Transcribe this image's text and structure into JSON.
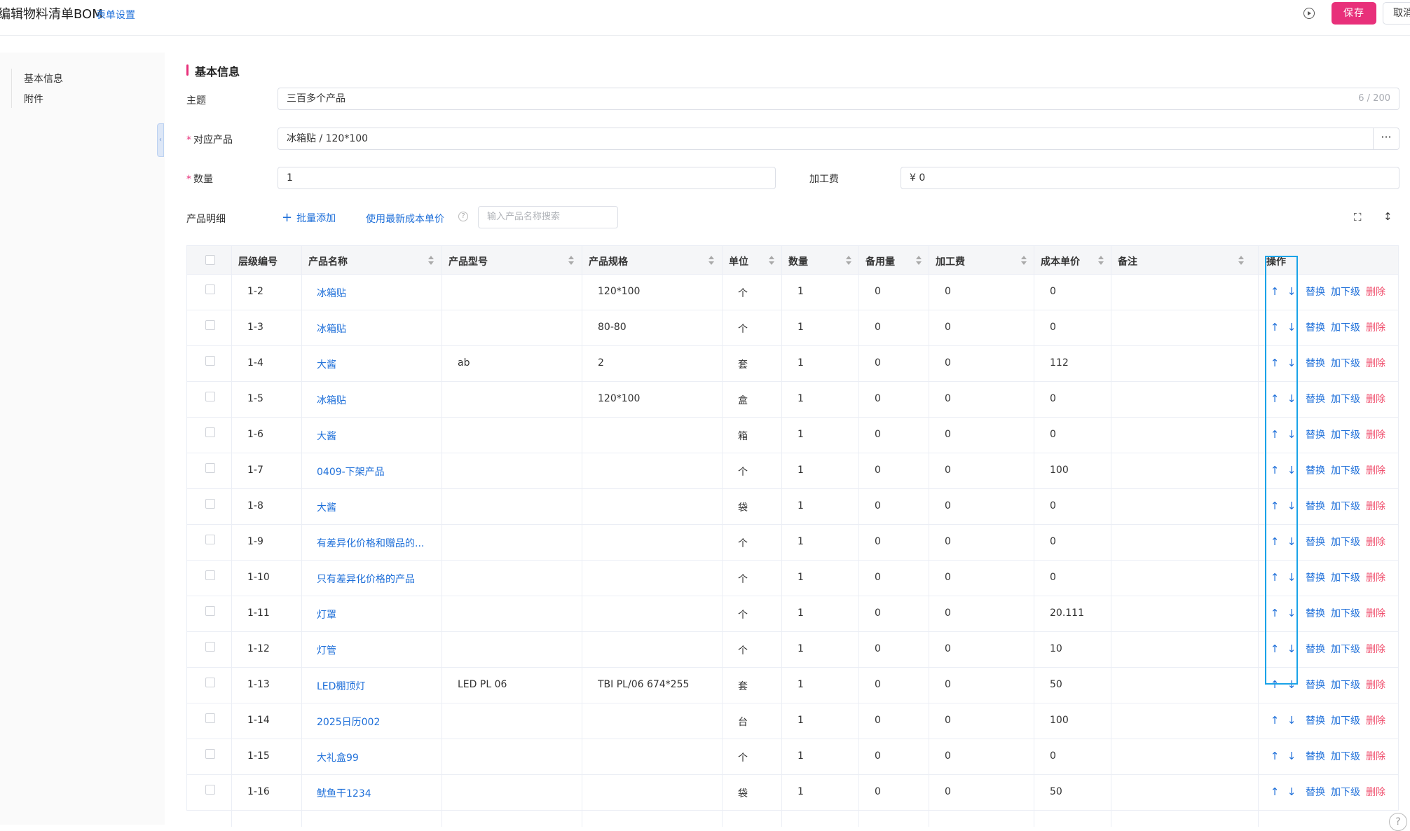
{
  "header": {
    "title": "编辑物料清单BOM",
    "form_settings": "表单设置",
    "save": "保存",
    "cancel": "取消"
  },
  "sidebar": {
    "items": [
      {
        "label": "基本信息"
      },
      {
        "label": "附件"
      }
    ]
  },
  "section": {
    "title": "基本信息"
  },
  "form": {
    "subject_label": "主题",
    "subject_value": "三百多个产品",
    "subject_counter": "6 / 200",
    "product_label": "对应产品",
    "product_value": "冰箱贴 / 120*100",
    "product_more": "···",
    "quantity_label": "数量",
    "quantity_value": "1",
    "fee_label": "加工费",
    "fee_value": "¥ 0",
    "required_mark": "*"
  },
  "toolbar": {
    "label": "产品明细",
    "batch_add": "批量添加",
    "use_latest_cost": "使用最新成本单价",
    "search_placeholder": "输入产品名称搜索"
  },
  "table": {
    "columns": [
      "层级编号",
      "产品名称",
      "产品型号",
      "产品规格",
      "单位",
      "数量",
      "备用量",
      "加工费",
      "成本单价",
      "备注",
      "操作"
    ],
    "ops": {
      "up": "↑",
      "down": "↓",
      "replace": "替换",
      "add_sub": "加下级",
      "delete": "删除"
    },
    "rows": [
      {
        "level": "1-2",
        "name": "冰箱贴",
        "model": "",
        "spec": "120*100",
        "unit": "个",
        "qty": "1",
        "spare": "0",
        "fee": "0",
        "cost": "0",
        "note": ""
      },
      {
        "level": "1-3",
        "name": "冰箱贴",
        "model": "",
        "spec": "80-80",
        "unit": "个",
        "qty": "1",
        "spare": "0",
        "fee": "0",
        "cost": "0",
        "note": ""
      },
      {
        "level": "1-4",
        "name": "大酱",
        "model": "ab",
        "spec": "2",
        "unit": "套",
        "qty": "1",
        "spare": "0",
        "fee": "0",
        "cost": "112",
        "note": ""
      },
      {
        "level": "1-5",
        "name": "冰箱贴",
        "model": "",
        "spec": "120*100",
        "unit": "盒",
        "qty": "1",
        "spare": "0",
        "fee": "0",
        "cost": "0",
        "note": ""
      },
      {
        "level": "1-6",
        "name": "大酱",
        "model": "",
        "spec": "",
        "unit": "箱",
        "qty": "1",
        "spare": "0",
        "fee": "0",
        "cost": "0",
        "note": ""
      },
      {
        "level": "1-7",
        "name": "0409-下架产品",
        "model": "",
        "spec": "",
        "unit": "个",
        "qty": "1",
        "spare": "0",
        "fee": "0",
        "cost": "100",
        "note": ""
      },
      {
        "level": "1-8",
        "name": "大酱",
        "model": "",
        "spec": "",
        "unit": "袋",
        "qty": "1",
        "spare": "0",
        "fee": "0",
        "cost": "0",
        "note": ""
      },
      {
        "level": "1-9",
        "name": "有差异化价格和赠品的...",
        "model": "",
        "spec": "",
        "unit": "个",
        "qty": "1",
        "spare": "0",
        "fee": "0",
        "cost": "0",
        "note": ""
      },
      {
        "level": "1-10",
        "name": "只有差异化价格的产品",
        "model": "",
        "spec": "",
        "unit": "个",
        "qty": "1",
        "spare": "0",
        "fee": "0",
        "cost": "0",
        "note": ""
      },
      {
        "level": "1-11",
        "name": "灯罩",
        "model": "",
        "spec": "",
        "unit": "个",
        "qty": "1",
        "spare": "0",
        "fee": "0",
        "cost": "20.111",
        "note": ""
      },
      {
        "level": "1-12",
        "name": "灯管",
        "model": "",
        "spec": "",
        "unit": "个",
        "qty": "1",
        "spare": "0",
        "fee": "0",
        "cost": "10",
        "note": ""
      },
      {
        "level": "1-13",
        "name": "LED棚顶灯",
        "model": "LED PL 06",
        "spec": "TBI PL/06 674*255",
        "unit": "套",
        "qty": "1",
        "spare": "0",
        "fee": "0",
        "cost": "50",
        "note": ""
      },
      {
        "level": "1-14",
        "name": "2025日历002",
        "model": "",
        "spec": "",
        "unit": "台",
        "qty": "1",
        "spare": "0",
        "fee": "0",
        "cost": "100",
        "note": ""
      },
      {
        "level": "1-15",
        "name": "大礼盒99",
        "model": "",
        "spec": "",
        "unit": "个",
        "qty": "1",
        "spare": "0",
        "fee": "0",
        "cost": "0",
        "note": ""
      },
      {
        "level": "1-16",
        "name": "鱿鱼干1234",
        "model": "",
        "spec": "",
        "unit": "袋",
        "qty": "1",
        "spare": "0",
        "fee": "0",
        "cost": "50",
        "note": ""
      }
    ]
  },
  "colors": {
    "primary": "#e8307a",
    "link": "#1e6fd9",
    "danger": "#f0506e",
    "highlight": "#1aa3e8"
  }
}
